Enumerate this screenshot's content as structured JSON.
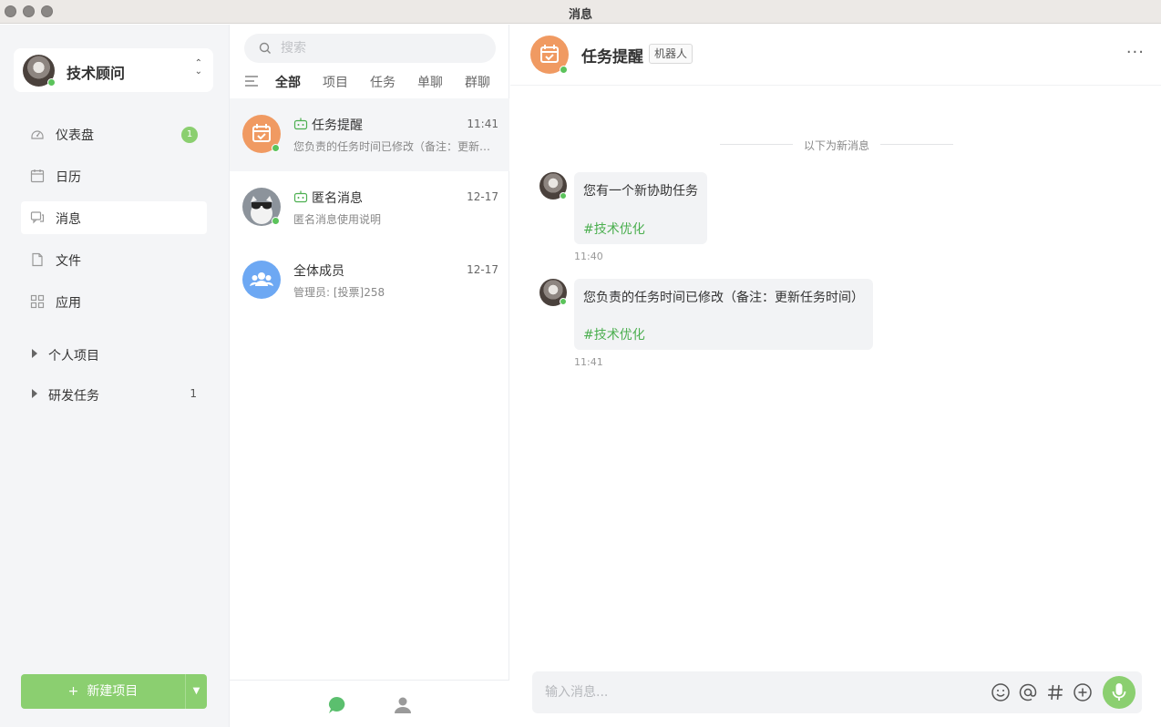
{
  "window": {
    "title": "消息"
  },
  "colors": {
    "accent": "#8bcf70",
    "online": "#5bc35b",
    "task_orange": "#f09a62",
    "group_blue": "#6da8f3",
    "tag_green": "#4caf50"
  },
  "sidebar": {
    "user": {
      "name": "技术顾问",
      "avatar": "user-avatar-photo",
      "status": "online"
    },
    "nav": [
      {
        "label": "仪表盘",
        "icon": "dashboard-icon",
        "badge": "1"
      },
      {
        "label": "日历",
        "icon": "calendar-icon"
      },
      {
        "label": "消息",
        "icon": "message-icon",
        "active": true
      },
      {
        "label": "文件",
        "icon": "file-icon"
      },
      {
        "label": "应用",
        "icon": "apps-icon"
      }
    ],
    "projects": [
      {
        "label": "个人项目",
        "count": ""
      },
      {
        "label": "研发任务",
        "count": "1"
      }
    ],
    "new_project_label": "新建项目",
    "new_project_plus": "+"
  },
  "list": {
    "search_placeholder": "搜索",
    "tabs": [
      "全部",
      "项目",
      "任务",
      "单聊",
      "群聊"
    ],
    "active_tab": "全部",
    "conversations": [
      {
        "name": "任务提醒",
        "time": "11:41",
        "preview": "您负责的任务时间已修改（备注：更新任务时间）",
        "bot": true,
        "avatar": "task-calendar-avatar",
        "online": true
      },
      {
        "name": "匿名消息",
        "time": "12-17",
        "preview": "匿名消息使用说明",
        "bot": true,
        "avatar": "anonymous-sunglasses-avatar",
        "online": true
      },
      {
        "name": "全体成员",
        "time": "12-17",
        "preview": "管理员: [投票]258",
        "bot": false,
        "avatar": "group-members-avatar",
        "online": false
      }
    ],
    "footer_icons": [
      "chat-bubble-icon",
      "contacts-person-icon"
    ]
  },
  "chat": {
    "title": "任务提醒",
    "tag": "机器人",
    "more": "···",
    "divider": "以下为新消息",
    "messages": [
      {
        "text": "您有一个新协助任务",
        "tag": "#技术优化",
        "time": "11:40"
      },
      {
        "text": "您负责的任务时间已修改（备注：更新任务时间）",
        "tag": "#技术优化",
        "time": "11:41"
      }
    ],
    "composer_placeholder": "输入消息...",
    "composer_icons": [
      "emoji-icon",
      "mention-at-icon",
      "hashtag-icon",
      "add-plus-icon",
      "microphone-icon"
    ]
  }
}
